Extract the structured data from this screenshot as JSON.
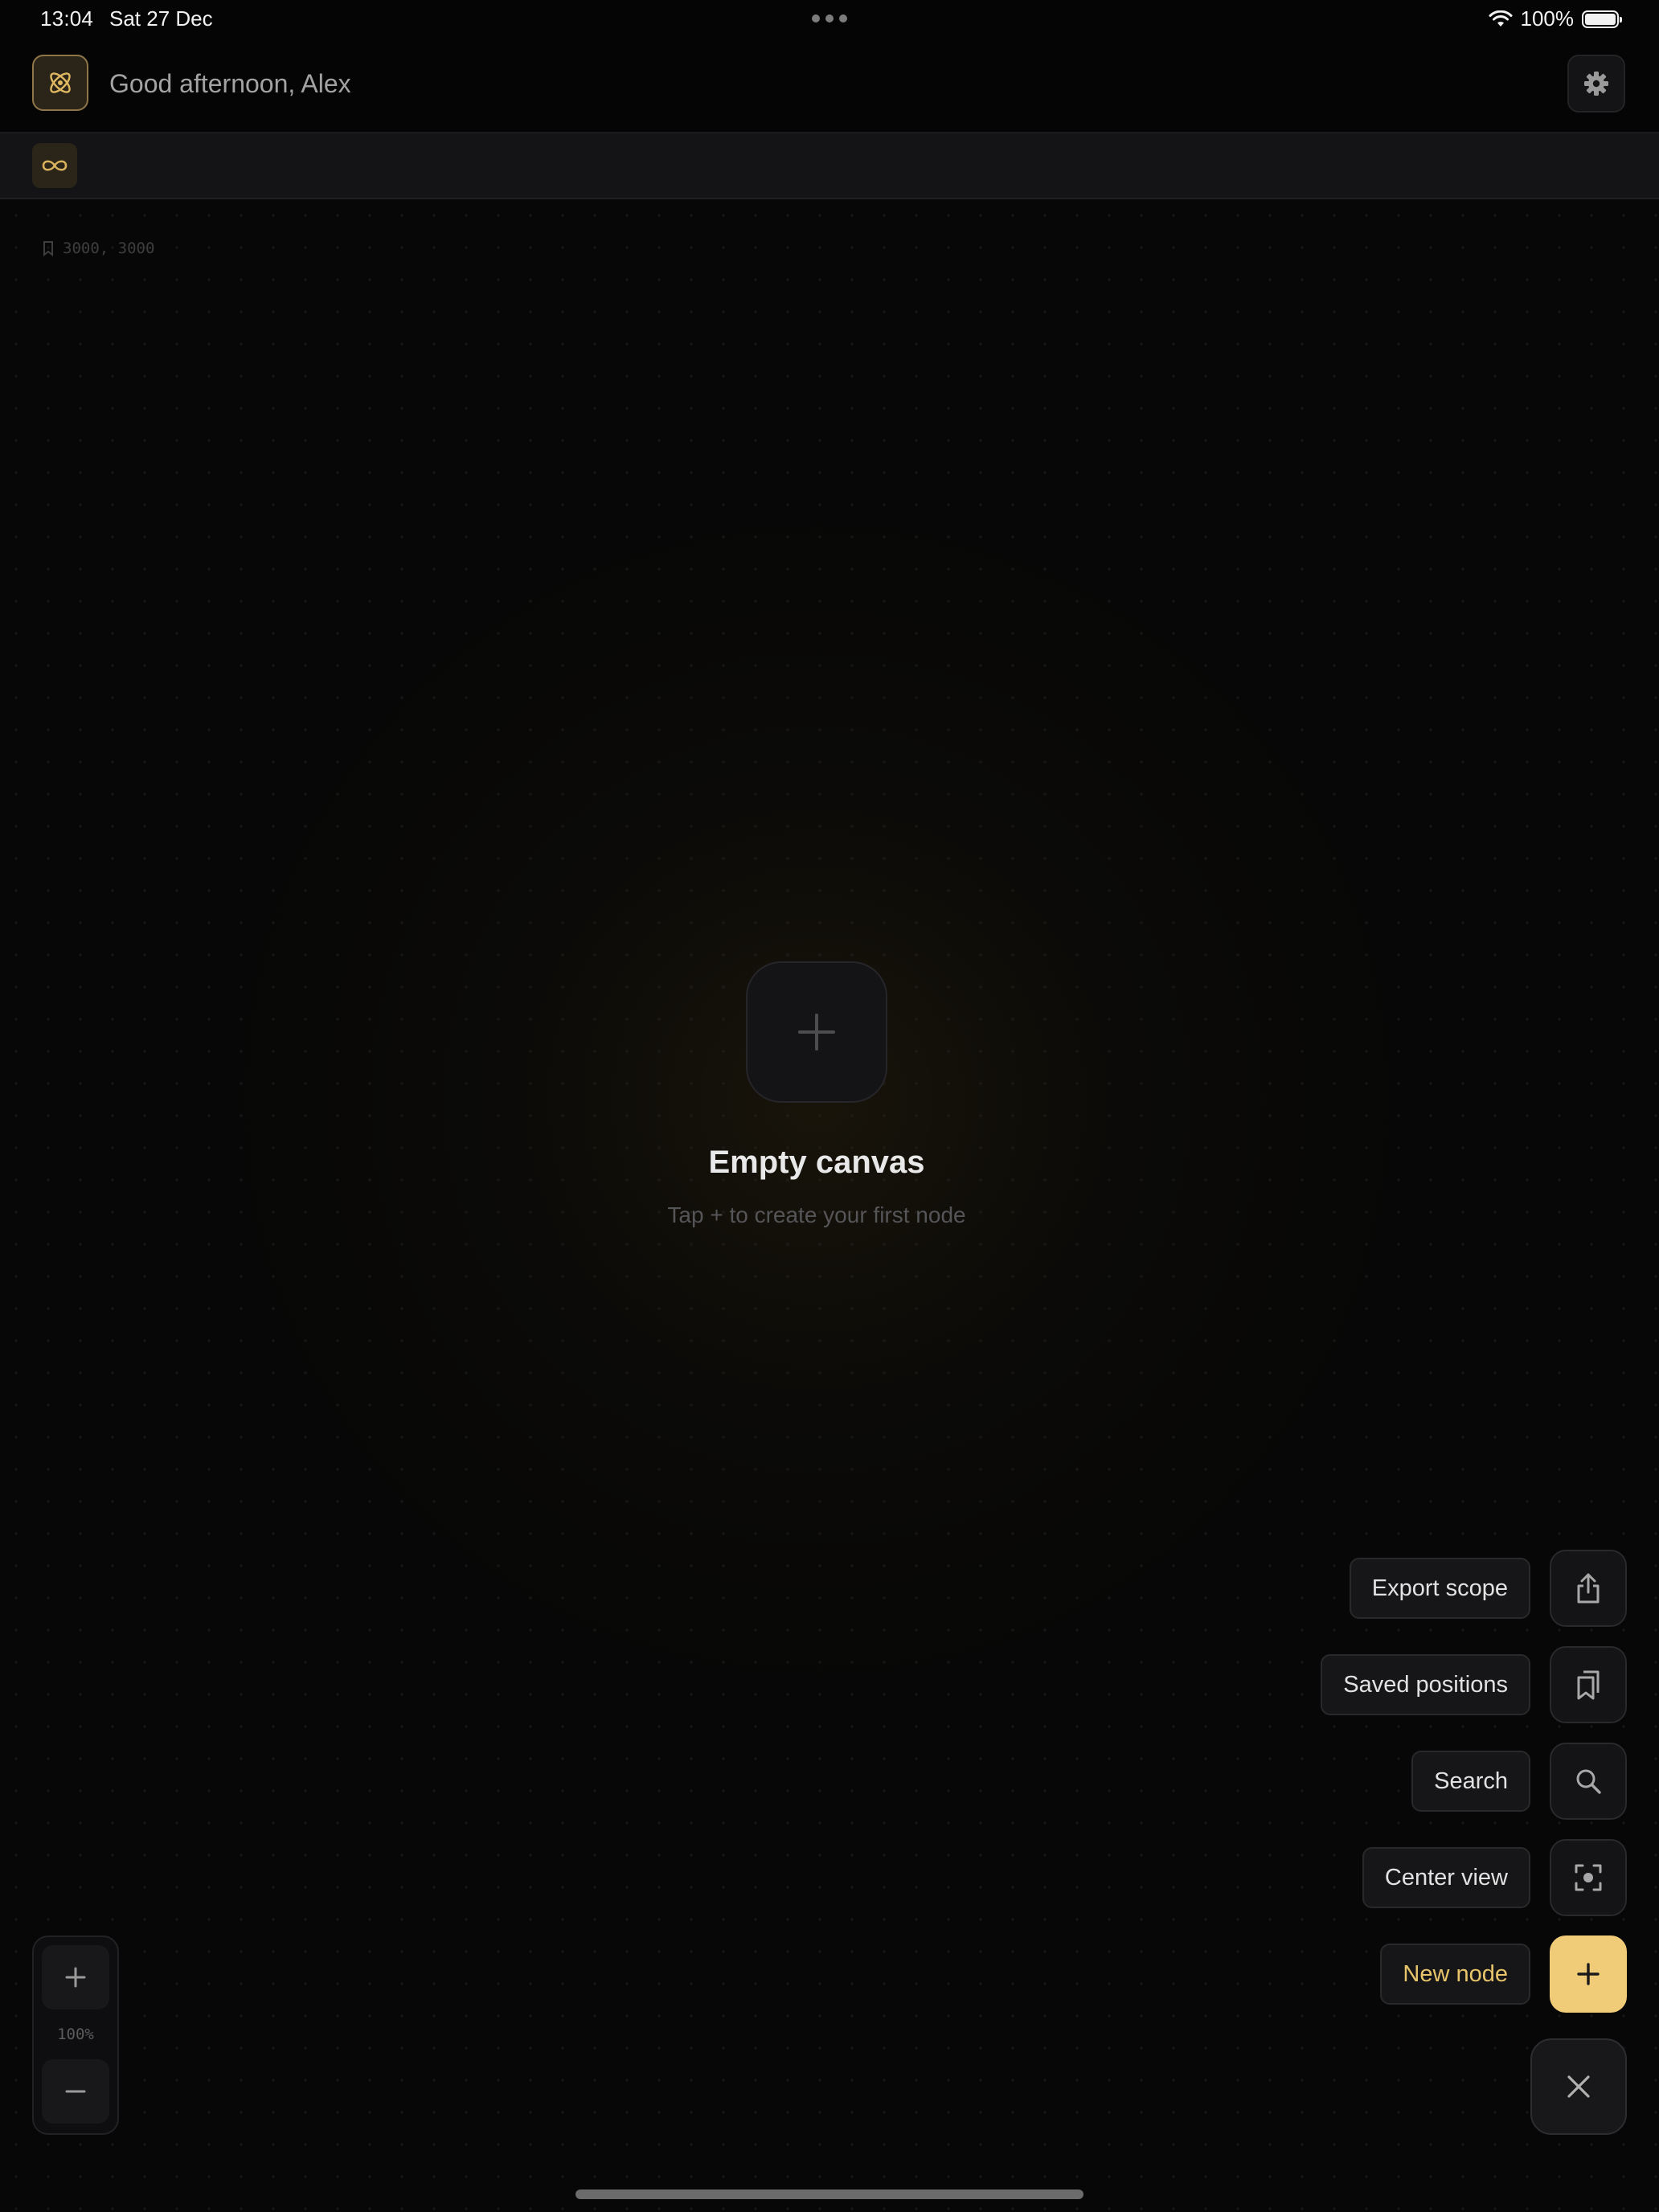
{
  "status_bar": {
    "time": "13:04",
    "date": "Sat 27 Dec",
    "battery": "100%",
    "wifi_icon": "wifi-icon",
    "battery_icon": "battery-full-icon"
  },
  "header": {
    "greeting": "Good afternoon, Alex",
    "logo_icon": "atom-icon",
    "settings_icon": "gear-icon"
  },
  "scope_bar": {
    "scope_icon": "infinity-icon"
  },
  "canvas": {
    "coordinates": "3000, 3000",
    "coordinates_icon": "bookmark-icon",
    "empty_state": {
      "title": "Empty canvas",
      "subtitle": "Tap + to create your first node",
      "add_icon": "plus-icon"
    }
  },
  "fab_menu": {
    "items": [
      {
        "label": "Export scope",
        "icon": "share-icon"
      },
      {
        "label": "Saved positions",
        "icon": "bookmarks-icon"
      },
      {
        "label": "Search",
        "icon": "search-icon"
      },
      {
        "label": "Center view",
        "icon": "focus-icon"
      },
      {
        "label": "New node",
        "icon": "plus-icon"
      }
    ],
    "close_icon": "close-icon"
  },
  "zoom": {
    "level": "100%",
    "zoom_in_icon": "plus-icon",
    "zoom_out_icon": "minus-icon"
  },
  "colors": {
    "background": "#050505",
    "accent": "#f0cc78",
    "accent_text": "#e8c56b",
    "surface": "#141416",
    "border": "#29292c"
  }
}
